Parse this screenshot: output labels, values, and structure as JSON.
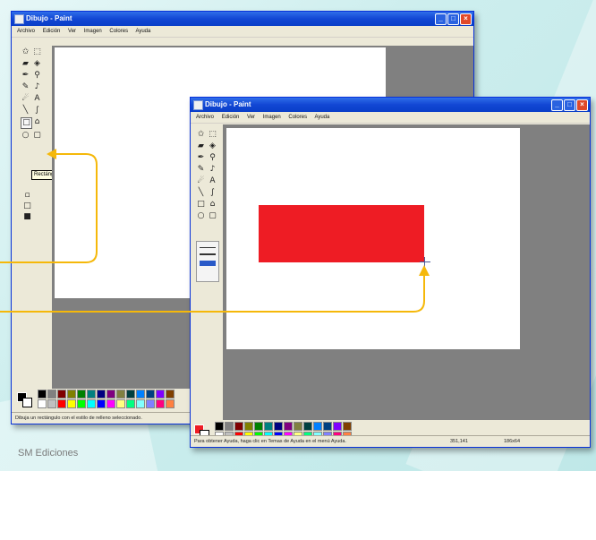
{
  "back_window": {
    "title": "Dibujo - Paint",
    "menu": [
      "Archivo",
      "Edición",
      "Ver",
      "Imagen",
      "Colores",
      "Ayuda"
    ],
    "tooltip": "Rectángulo",
    "status": "Dibuja un rectángulo con el estilo de relleno seleccionado."
  },
  "front_window": {
    "title": "Dibujo - Paint",
    "menu": [
      "Archivo",
      "Edición",
      "Ver",
      "Imagen",
      "Colores",
      "Ayuda"
    ],
    "status": "Para obtener Ayuda, haga clic en Temas de Ayuda en el menú Ayuda.",
    "status_coord": "351,141",
    "status_size": "186x64",
    "rectangle_color": "#ee1c24"
  },
  "tool_icons": [
    "free-select-icon",
    "rect-select-icon",
    "eraser-icon",
    "fill-icon",
    "eyedropper-icon",
    "magnifier-icon",
    "pencil-icon",
    "brush-icon",
    "airbrush-icon",
    "text-icon",
    "line-icon",
    "curve-icon",
    "rectangle-icon",
    "polygon-icon",
    "ellipse-icon",
    "rounded-rect-icon"
  ],
  "palette_colors": [
    "#000000",
    "#808080",
    "#800000",
    "#808000",
    "#008000",
    "#008080",
    "#000080",
    "#800080",
    "#808040",
    "#004040",
    "#0080ff",
    "#004080",
    "#8000ff",
    "#804000",
    "#ffffff",
    "#c0c0c0",
    "#ff0000",
    "#ffff00",
    "#00ff00",
    "#00ffff",
    "#0000ff",
    "#ff00ff",
    "#ffff80",
    "#00ff80",
    "#80ffff",
    "#8080ff",
    "#ff0080",
    "#ff8040"
  ],
  "accent_color": "#f5b80a",
  "credit": "SM Ediciones"
}
